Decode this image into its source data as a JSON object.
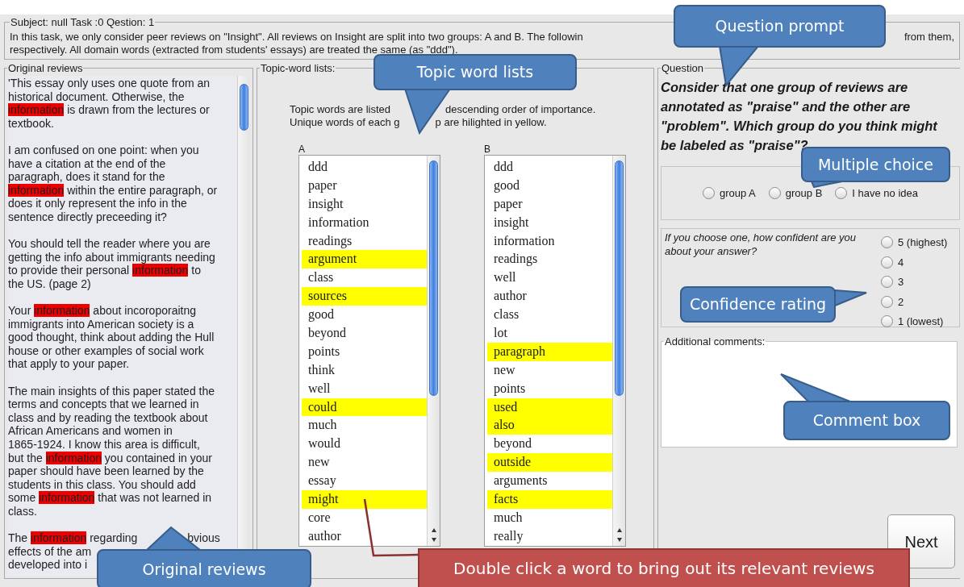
{
  "header": {
    "legend": "Subject: null  Task :0  Qestion: 1",
    "intro_lines": [
      [
        "In this task, we only consider peer reviews on \"Insight\". All reviews on Insight are split into two groups: A and B. The followin",
        "from them,"
      ],
      [
        "respectively. All domain words (extracted from students' essays) are treated the same (as \"ddd\")."
      ]
    ]
  },
  "reviews": {
    "legend": "Original reviews",
    "paragraphs": [
      [
        [
          {
            "text": "'This essay only uses one quote from an",
            "highlight": false
          }
        ],
        [
          {
            "text": "historical document.  Otherwise, the",
            "highlight": false
          }
        ],
        [
          {
            "text": "information",
            "highlight": true
          },
          {
            "text": " is drawn from the lectures or",
            "highlight": false
          }
        ],
        [
          {
            "text": "textbook.",
            "highlight": false
          }
        ]
      ],
      [
        [
          {
            "text": "I am confused on one point: when you",
            "highlight": false
          }
        ],
        [
          {
            "text": "have a citation at the end of the",
            "highlight": false
          }
        ],
        [
          {
            "text": "paragraph, does it stand for the",
            "highlight": false
          }
        ],
        [
          {
            "text": "information",
            "highlight": true
          },
          {
            "text": " within the entire paragraph, or",
            "highlight": false
          }
        ],
        [
          {
            "text": "does it only represent the info in the",
            "highlight": false
          }
        ],
        [
          {
            "text": "sentence directly preceeding it?",
            "highlight": false
          }
        ]
      ],
      [
        [
          {
            "text": "You should tell the reader where you are",
            "highlight": false
          }
        ],
        [
          {
            "text": "getting the info about immigrants needing",
            "highlight": false
          }
        ],
        [
          {
            "text": "to provide their personal ",
            "highlight": false
          },
          {
            "text": "information",
            "highlight": true
          },
          {
            "text": " to",
            "highlight": false
          }
        ],
        [
          {
            "text": "the US. (page 2)",
            "highlight": false
          }
        ]
      ],
      [
        [
          {
            "text": "Your ",
            "highlight": false
          },
          {
            "text": "information",
            "highlight": true
          },
          {
            "text": " about incoroporaitng",
            "highlight": false
          }
        ],
        [
          {
            "text": "immigrants into American society is a",
            "highlight": false
          }
        ],
        [
          {
            "text": "good thought, think about adding the Hull",
            "highlight": false
          }
        ],
        [
          {
            "text": "house or other examples of social work",
            "highlight": false
          }
        ],
        [
          {
            "text": "that apply to your paper.",
            "highlight": false
          }
        ]
      ],
      [
        [
          {
            "text": "The main insights of this paper stated the",
            "highlight": false
          }
        ],
        [
          {
            "text": "terms and concepts that we learned in",
            "highlight": false
          }
        ],
        [
          {
            "text": "class and by reading the textbook about",
            "highlight": false
          }
        ],
        [
          {
            "text": "African Americans and women in",
            "highlight": false
          }
        ],
        [
          {
            "text": "1865-1924. I know this area is difficult,",
            "highlight": false
          }
        ],
        [
          {
            "text": "but the ",
            "highlight": false
          },
          {
            "text": "information",
            "highlight": true
          },
          {
            "text": " you contained in your",
            "highlight": false
          }
        ],
        [
          {
            "text": "paper should have been learned by the",
            "highlight": false
          }
        ],
        [
          {
            "text": "students in this class. You should add",
            "highlight": false
          }
        ],
        [
          {
            "text": "some ",
            "highlight": false
          },
          {
            "text": "information",
            "highlight": true
          },
          {
            "text": " that was not learned in",
            "highlight": false
          }
        ],
        [
          {
            "text": "class.",
            "highlight": false
          }
        ]
      ],
      [
        [
          {
            "text": "The ",
            "highlight": false
          },
          {
            "text": "information",
            "highlight": true
          },
          {
            "text": " regarding",
            "highlight": false
          },
          {
            "text": "bvious",
            "highlight": false,
            "covered_before": true
          }
        ],
        [
          {
            "text": "effects of the am",
            "highlight": false
          }
        ],
        [
          {
            "text": "developed into i",
            "highlight": false
          }
        ]
      ]
    ]
  },
  "topics": {
    "legend": "Topic-word lists:",
    "instruction_lines": [
      [
        "Topic words are listed",
        "descending order of importance."
      ],
      [
        "Unique words of each g",
        "p are hilighted in yellow."
      ]
    ],
    "lists": [
      {
        "label": "A",
        "words": [
          {
            "text": "ddd",
            "unique": false
          },
          {
            "text": "paper",
            "unique": false
          },
          {
            "text": "insight",
            "unique": false
          },
          {
            "text": "information",
            "unique": false
          },
          {
            "text": "readings",
            "unique": false
          },
          {
            "text": "argument",
            "unique": true
          },
          {
            "text": "class",
            "unique": false
          },
          {
            "text": "sources",
            "unique": true
          },
          {
            "text": "good",
            "unique": false
          },
          {
            "text": "beyond",
            "unique": false
          },
          {
            "text": "points",
            "unique": false
          },
          {
            "text": "think",
            "unique": false
          },
          {
            "text": "well",
            "unique": false
          },
          {
            "text": "could",
            "unique": true
          },
          {
            "text": "much",
            "unique": false
          },
          {
            "text": "would",
            "unique": false
          },
          {
            "text": "new",
            "unique": false
          },
          {
            "text": "essay",
            "unique": false
          },
          {
            "text": "might",
            "unique": true
          },
          {
            "text": "core",
            "unique": false
          },
          {
            "text": "author",
            "unique": false
          }
        ]
      },
      {
        "label": "B",
        "words": [
          {
            "text": "ddd",
            "unique": false
          },
          {
            "text": "good",
            "unique": false
          },
          {
            "text": "paper",
            "unique": false
          },
          {
            "text": "insight",
            "unique": false
          },
          {
            "text": "information",
            "unique": false
          },
          {
            "text": "readings",
            "unique": false
          },
          {
            "text": "well",
            "unique": false
          },
          {
            "text": "author",
            "unique": false
          },
          {
            "text": "class",
            "unique": false
          },
          {
            "text": "lot",
            "unique": false
          },
          {
            "text": "paragraph",
            "unique": true
          },
          {
            "text": "new",
            "unique": false
          },
          {
            "text": "points",
            "unique": false
          },
          {
            "text": "used",
            "unique": true
          },
          {
            "text": "also",
            "unique": true
          },
          {
            "text": "beyond",
            "unique": false
          },
          {
            "text": "outside",
            "unique": true
          },
          {
            "text": "arguments",
            "unique": false
          },
          {
            "text": "facts",
            "unique": true
          },
          {
            "text": "much",
            "unique": false
          },
          {
            "text": "really",
            "unique": false
          }
        ]
      }
    ]
  },
  "question": {
    "legend": "Question",
    "prompt": "Consider that one group of reviews are annotated as \"praise\" and the other are \"problem\". Which group do you think might be labeled as \"praise\"?",
    "choices": [
      {
        "label": "group A",
        "selected": false
      },
      {
        "label": "group B",
        "selected": false
      },
      {
        "label": "I have no idea",
        "selected": false
      }
    ],
    "confidence_prompt": "If you choose one, how confident are you about your answer?",
    "confidence": [
      {
        "label": "5 (highest)",
        "selected": false
      },
      {
        "label": "4",
        "selected": false
      },
      {
        "label": "3",
        "selected": false
      },
      {
        "label": "2",
        "selected": false
      },
      {
        "label": "1 (lowest)",
        "selected": false
      }
    ],
    "comments_legend": "Additional comments:",
    "next_button": "Next"
  },
  "callouts": [
    {
      "kind": "bubble",
      "text": "Question prompt"
    },
    {
      "kind": "bubble",
      "text": "Topic word lists"
    },
    {
      "kind": "bubble",
      "text": "Multiple choice"
    },
    {
      "kind": "bubble",
      "text": "Confidence rating"
    },
    {
      "kind": "bubble",
      "text": "Comment box"
    },
    {
      "kind": "bubble",
      "text": "Original reviews"
    },
    {
      "kind": "banner",
      "text": "Double click a word to bring out its relevant reviews"
    }
  ]
}
